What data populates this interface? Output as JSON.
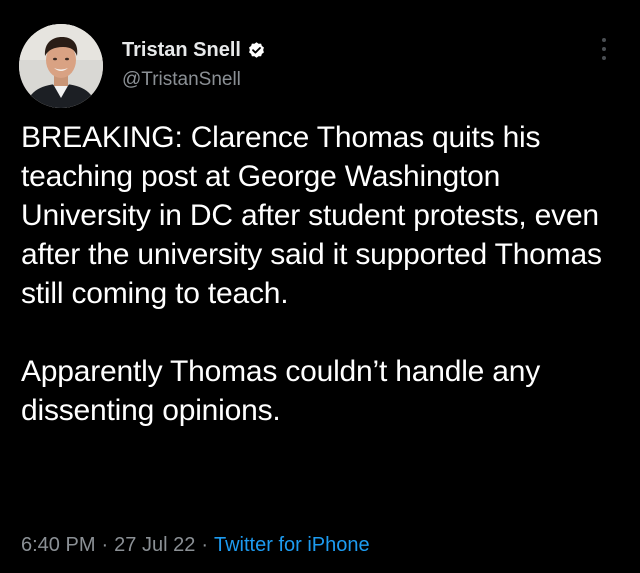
{
  "author": {
    "name": "Tristan Snell",
    "handle": "@TristanSnell",
    "verified": true
  },
  "tweet": {
    "paragraph1": "BREAKING: Clarence Thomas quits his teaching post at George Washington University in DC after student protests, even after the university said it supported Thomas still coming to teach.",
    "paragraph2": "Apparently Thomas couldn’t handle any dissenting opinions."
  },
  "meta": {
    "time": "6:40 PM",
    "separator": "·",
    "date": "27 Jul 22",
    "source": "Twitter for iPhone"
  },
  "icons": {
    "verified": "verified-badge-icon",
    "more": "more-options-icon"
  },
  "colors": {
    "background": "#000000",
    "text": "#ffffff",
    "secondary_text": "#8b9095",
    "link": "#1d9bf0"
  }
}
